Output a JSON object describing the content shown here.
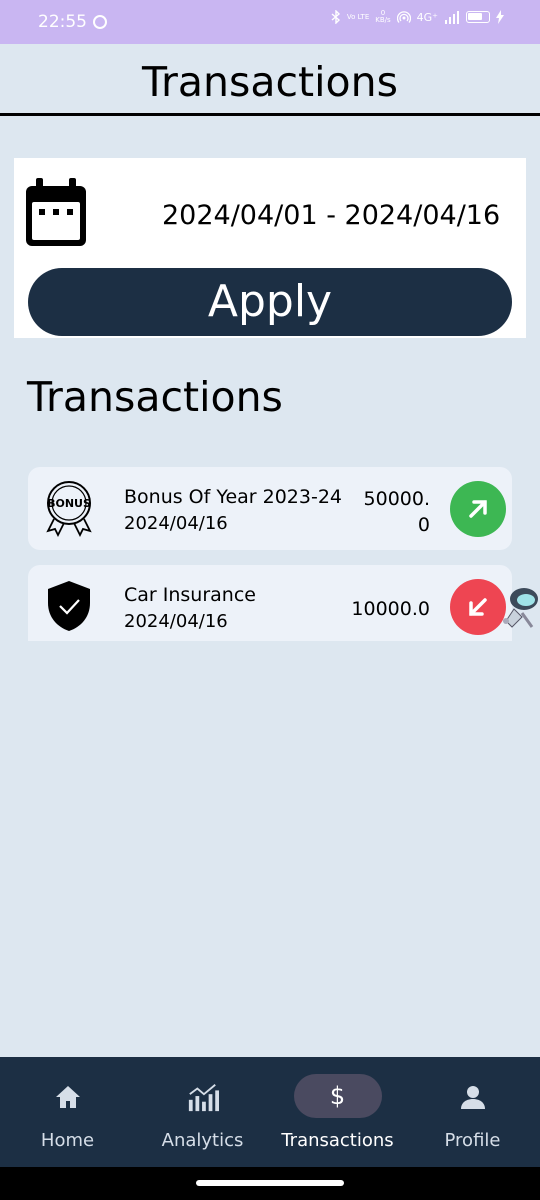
{
  "status_bar": {
    "time": "22:55",
    "network": "4G⁺",
    "speed_value": "0",
    "speed_unit": "KB/s",
    "volte": "Vo LTE"
  },
  "header": {
    "title": "Transactions"
  },
  "filter": {
    "date_range": "2024/04/01 - 2024/04/16",
    "apply_label": "Apply"
  },
  "section": {
    "title": "Transactions"
  },
  "transactions": [
    {
      "name": "Bonus Of Year 2023-24",
      "date": "2024/04/16",
      "amount": "50000.0",
      "direction": "income",
      "icon": "bonus-badge-icon",
      "badge_icon": "arrow-up-right-icon",
      "badge_color": "#3db753"
    },
    {
      "name": "Car Insurance",
      "date": "2024/04/16",
      "amount": "10000.0",
      "direction": "expense",
      "icon": "shield-check-icon",
      "badge_icon": "arrow-down-left-icon",
      "badge_color": "#ee4552"
    }
  ],
  "nav": {
    "items": [
      {
        "label": "Home",
        "icon": "home-icon"
      },
      {
        "label": "Analytics",
        "icon": "analytics-icon"
      },
      {
        "label": "Transactions",
        "icon": "dollar-icon",
        "glyph": "$"
      },
      {
        "label": "Profile",
        "icon": "person-icon"
      }
    ],
    "active": "Transactions"
  },
  "colors": {
    "primary": "#1c2f44",
    "background": "#dde7f0",
    "status_bar": "#c9b6f2",
    "income": "#3db753",
    "expense": "#ee4552"
  }
}
